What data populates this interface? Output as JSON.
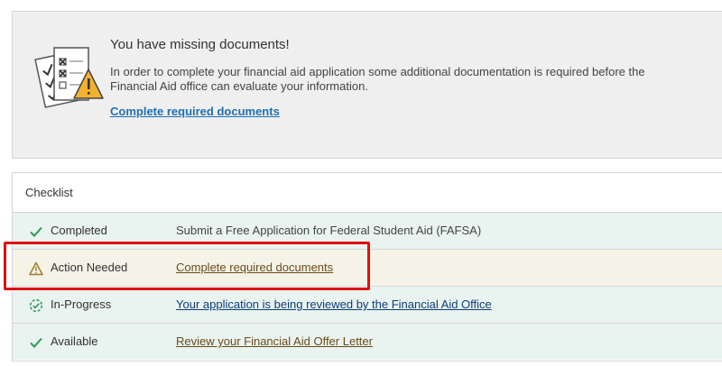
{
  "alert": {
    "title": "You have missing documents!",
    "body": "In order to complete your financial aid application some additional documentation is required before the Financial Aid office can evaluate your information.",
    "link": "Complete required documents",
    "icon": "documents-warning-icon"
  },
  "checklist": {
    "title": "Checklist",
    "items": [
      {
        "status": "Completed",
        "text": "Submit a Free Application for Federal Student Aid (FAFSA)",
        "icon": "check-icon"
      },
      {
        "status": "Action Needed",
        "text": "Complete required documents",
        "icon": "warning-icon"
      },
      {
        "status": "In-Progress",
        "text": "Your application is being reviewed by the Financial Aid Office",
        "icon": "progress-icon"
      },
      {
        "status": "Available",
        "text": "Review your Financial Aid Offer Letter",
        "icon": "check-icon"
      }
    ]
  },
  "colors": {
    "success": "#2e9a5a",
    "warning": "#9a7d27",
    "link": "#1f6fb2",
    "highlight": "#e01010"
  }
}
